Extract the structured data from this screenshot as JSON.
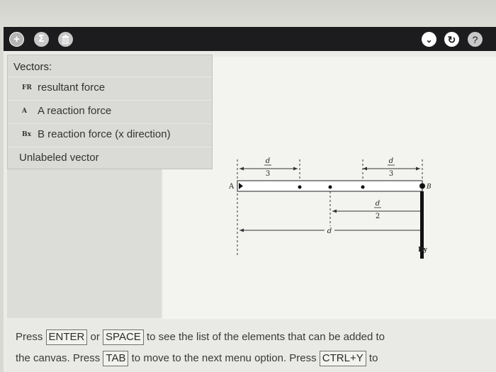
{
  "toolbar": {
    "plus_symbol": "+",
    "sigma_symbol": "Σ",
    "trash_symbol": "⌫",
    "chevron_symbol": "⌄",
    "undo_symbol": "↻",
    "help_symbol": "?"
  },
  "vectors_panel": {
    "title": "Vectors:",
    "items": [
      {
        "symbol": "FR",
        "label": "resultant force"
      },
      {
        "symbol": "A",
        "label": "A reaction force"
      },
      {
        "symbol": "Bx",
        "label": "B reaction force (x direction)"
      },
      {
        "symbol": "",
        "label": "Unlabeled vector"
      }
    ]
  },
  "diagram": {
    "label_A": "A",
    "label_B": "B",
    "label_By": "By",
    "dim_d": "d",
    "dim_3": "3",
    "dim_2": "2",
    "dim_d_bottom": "d"
  },
  "footer": {
    "press1": "Press",
    "key_enter": "ENTER",
    "or": "or",
    "key_space": "SPACE",
    "text1": "to see the list of the elements that can be added to",
    "text2a": "the canvas. Press",
    "key_tab": "TAB",
    "text2b": "to move to the next menu option. Press",
    "key_ctrly": "CTRL+Y",
    "text2c": "to"
  }
}
